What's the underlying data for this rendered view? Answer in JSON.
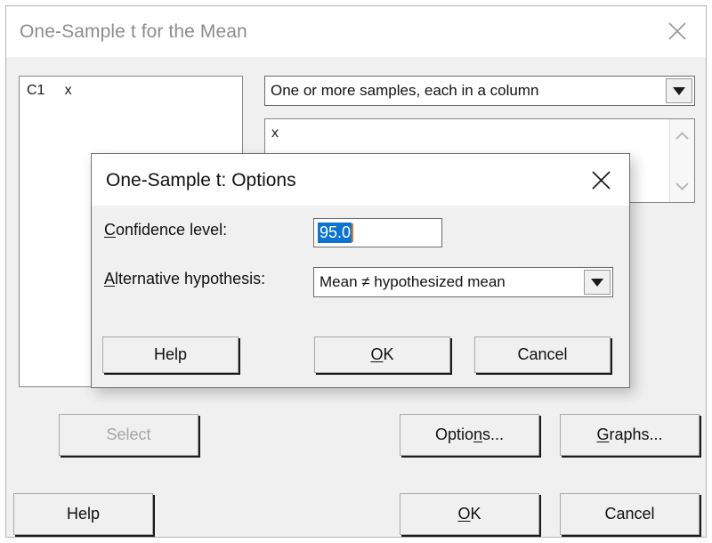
{
  "main_window": {
    "title": "One-Sample t for the Mean",
    "close_icon": "close-icon",
    "variable_list": {
      "items": [
        "C1     x"
      ]
    },
    "data_source_combo": {
      "value": "One or more samples, each in a column",
      "arrow_icon": "chevron-down-icon"
    },
    "samples_box": {
      "value": "x",
      "scroll_up_icon": "chevron-up-icon",
      "scroll_down_icon": "chevron-down-icon"
    },
    "buttons": {
      "select": {
        "label": "Select",
        "disabled": true
      },
      "options": {
        "label": "Optio",
        "accel": "n",
        "label_tail": "s..."
      },
      "graphs": {
        "accel": "G",
        "label_tail": "raphs..."
      },
      "help": {
        "label": "Help"
      },
      "ok": {
        "accel": "O",
        "label_tail": "K"
      },
      "cancel": {
        "label": "Cancel"
      }
    }
  },
  "modal": {
    "title": "One-Sample t: Options",
    "close_icon": "close-icon",
    "confidence_level": {
      "label_accel": "C",
      "label_tail": "onfidence level:",
      "value": "95.0",
      "selected": true
    },
    "alternative_hypothesis": {
      "label_accel": "A",
      "label_tail": "lternative hypothesis:",
      "value": "Mean ≠ hypothesized mean",
      "arrow_icon": "chevron-down-icon"
    },
    "buttons": {
      "help": {
        "label": "Help"
      },
      "ok": {
        "accel": "O",
        "label_tail": "K"
      },
      "cancel": {
        "label": "Cancel"
      }
    }
  },
  "colors": {
    "dialog_bg": "#f0f0f0",
    "titlebar_bg": "#ffffff",
    "title_text_inactive": "#8d8d8d",
    "title_text_active": "#111111",
    "selection_blue": "#0a74d0",
    "caret_orange": "#e07a1f",
    "disabled_text": "#a6a6a6"
  }
}
